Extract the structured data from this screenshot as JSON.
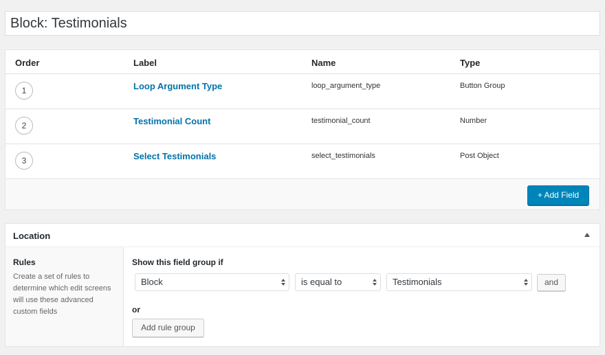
{
  "title": {
    "value": "Block: Testimonials"
  },
  "fields": {
    "headers": {
      "order": "Order",
      "label": "Label",
      "name": "Name",
      "type": "Type"
    },
    "rows": [
      {
        "order": "1",
        "label": "Loop Argument Type",
        "name": "loop_argument_type",
        "type": "Button Group"
      },
      {
        "order": "2",
        "label": "Testimonial Count",
        "name": "testimonial_count",
        "type": "Number"
      },
      {
        "order": "3",
        "label": "Select Testimonials",
        "name": "select_testimonials",
        "type": "Post Object"
      }
    ],
    "add_field_label": "+ Add Field"
  },
  "location": {
    "title": "Location",
    "rules_title": "Rules",
    "rules_desc": "Create a set of rules to determine which edit screens will use these advanced custom fields",
    "show_if": "Show this field group if",
    "param_value": "Block",
    "operator_value": "is equal to",
    "value_value": "Testimonials",
    "and_label": "and",
    "or_label": "or",
    "add_rule_group_label": "Add rule group"
  },
  "colors": {
    "link": "#0073aa",
    "primary_button": "#0085ba",
    "background": "#f1f1f1"
  },
  "icons": {
    "toggle": "triangle-up-icon",
    "select": "select-arrows-icon"
  }
}
